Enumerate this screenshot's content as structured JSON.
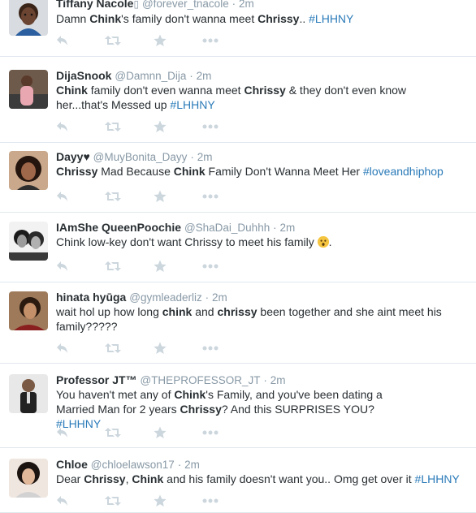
{
  "tweets": [
    {
      "name": "Tiffany Nacole",
      "name_suffix": "▯",
      "handle": "@forever_tnacole",
      "sep": "·",
      "time": "2m",
      "parts": [
        {
          "t": "Damn "
        },
        {
          "t": "Chink",
          "b": true
        },
        {
          "t": "'s family don't wanna meet "
        },
        {
          "t": "Chrissy",
          "b": true
        },
        {
          "t": ".. "
        },
        {
          "t": "#LHHNY",
          "h": true
        }
      ]
    },
    {
      "name": "DijaSnook",
      "handle": "@Damnn_Dija",
      "sep": "·",
      "time": "2m",
      "parts": [
        {
          "t": "Chink",
          "b": true
        },
        {
          "t": " family don't even wanna meet "
        },
        {
          "t": "Chrissy",
          "b": true
        },
        {
          "t": " & they don't even know her...that's Messed up "
        },
        {
          "t": "#LHHNY",
          "h": true
        }
      ]
    },
    {
      "name": "Dayy♥",
      "handle": "@MuyBonita_Dayy",
      "sep": "·",
      "time": "2m",
      "parts": [
        {
          "t": "Chrissy",
          "b": true
        },
        {
          "t": " Mad Because "
        },
        {
          "t": "Chink",
          "b": true
        },
        {
          "t": " Family Don't Wanna Meet Her "
        },
        {
          "t": "#loveandhiphop",
          "h": true
        }
      ]
    },
    {
      "name": "IAmShe QueenPoochie",
      "handle": "@ShaDai_Duhhh",
      "sep": "·",
      "time": "2m",
      "parts": [
        {
          "t": "Chink low-key don't want Chrissy to meet his family "
        },
        {
          "emoji": "astonished-face-emoji"
        },
        {
          "t": "."
        }
      ]
    },
    {
      "name": "hinata hyūga",
      "handle": "@gymleaderliz",
      "sep": "·",
      "time": "2m",
      "parts": [
        {
          "t": "wait hol up how long "
        },
        {
          "t": "chink",
          "b": true
        },
        {
          "t": " and "
        },
        {
          "t": "chrissy",
          "b": true
        },
        {
          "t": " been together and she aint meet his family?????"
        }
      ]
    },
    {
      "name": "Professor JT™",
      "handle": "@THEPROFESSOR_JT",
      "sep": "·",
      "time": "2m",
      "parts": [
        {
          "t": "You haven't met any of "
        },
        {
          "t": "Chink",
          "b": true
        },
        {
          "t": "'s Family, and you've been dating a Married Man for 2 years "
        },
        {
          "t": "Chrissy",
          "b": true
        },
        {
          "t": "? And this SURPRISES YOU? "
        },
        {
          "t": "#LHHNY",
          "h": true
        }
      ]
    },
    {
      "name": "Chloe",
      "handle": "@chloelawson17",
      "sep": "·",
      "time": "2m",
      "parts": [
        {
          "t": "Dear "
        },
        {
          "t": "Chrissy",
          "b": true
        },
        {
          "t": ", "
        },
        {
          "t": "Chink",
          "b": true
        },
        {
          "t": " and his family doesn't want you.. Omg get over it "
        },
        {
          "t": "#LHHNY",
          "h": true
        }
      ]
    }
  ],
  "icons": {
    "reply": "reply-icon",
    "retweet": "retweet-icon",
    "favorite": "star-icon",
    "more": "more-icon"
  },
  "colors": {
    "text": "#292f33",
    "muted": "#8899a6",
    "hashtag": "#2b7bb9",
    "icon": "#ccd6dd",
    "divider": "#e1e8ed"
  }
}
